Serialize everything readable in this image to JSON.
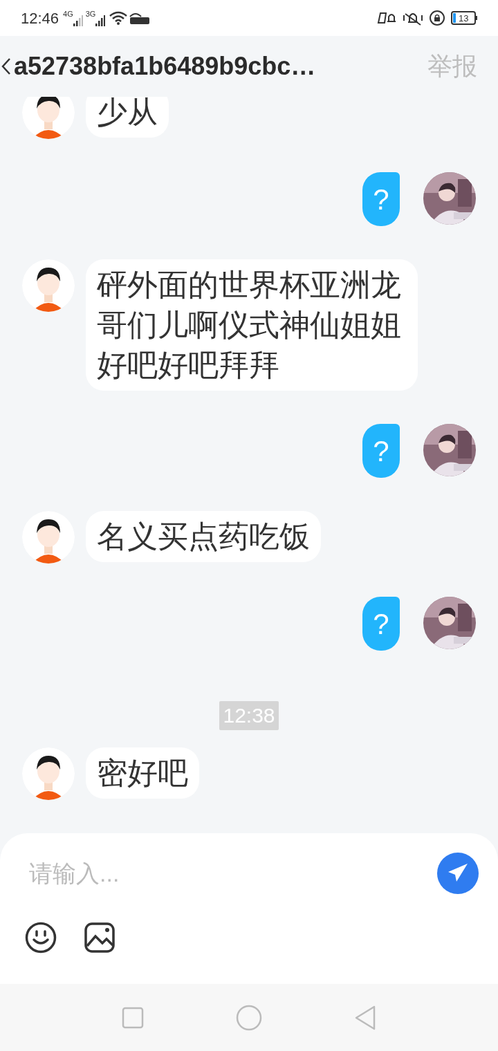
{
  "status_bar": {
    "time": "12:46",
    "network_1": "4G",
    "network_2": "3G",
    "battery": "13"
  },
  "header": {
    "title": "a52738bfa1b6489b9cbc…",
    "report": "举报"
  },
  "messages": [
    {
      "kind": "incoming",
      "text": "少从"
    },
    {
      "kind": "outgoing",
      "text": "?"
    },
    {
      "kind": "incoming",
      "text": "砰外面的世界杯亚洲龙哥们儿啊仪式神仙姐姐好吧好吧拜拜"
    },
    {
      "kind": "outgoing",
      "text": "?"
    },
    {
      "kind": "incoming",
      "text": "名义买点药吃饭"
    },
    {
      "kind": "outgoing",
      "text": "?"
    },
    {
      "kind": "time",
      "text": "12:38"
    },
    {
      "kind": "incoming",
      "text": "密好吧"
    }
  ],
  "composer": {
    "placeholder": "请输入..."
  }
}
